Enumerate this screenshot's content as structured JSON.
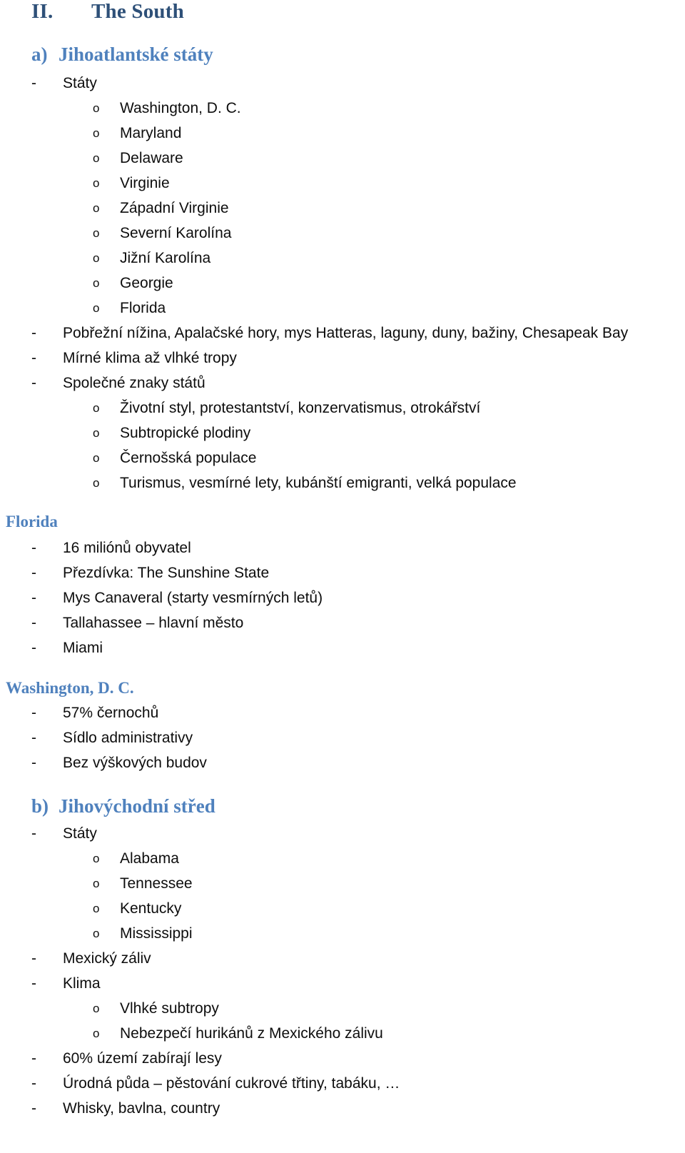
{
  "document": {
    "title": "The South",
    "language": "cs",
    "colors": {
      "heading_dark_blue": "#2E5078",
      "heading_steel_blue": "#4F81BD",
      "body_text": "#0D0D0D",
      "page_background": "#FFFFFF"
    }
  },
  "section_main": {
    "marker": "II.",
    "title": "The South"
  },
  "subsection_a": {
    "marker": "a)",
    "title": "Jihoatlantské státy",
    "items": [
      {
        "bullet": "-",
        "text": "Státy"
      },
      {
        "bullet": "o",
        "text": "Washington, D. C."
      },
      {
        "bullet": "o",
        "text": "Maryland"
      },
      {
        "bullet": "o",
        "text": "Delaware"
      },
      {
        "bullet": "o",
        "text": "Virginie"
      },
      {
        "bullet": "o",
        "text": "Západní Virginie"
      },
      {
        "bullet": "o",
        "text": "Severní Karolína"
      },
      {
        "bullet": "o",
        "text": "Jižní Karolína"
      },
      {
        "bullet": "o",
        "text": "Georgie"
      },
      {
        "bullet": "o",
        "text": "Florida"
      },
      {
        "bullet": "-",
        "text": "Pobřežní nížina, Apalačské hory, mys Hatteras, laguny, duny, bažiny, Chesapeak Bay"
      },
      {
        "bullet": "-",
        "text": "Mírné klima až vlhké tropy"
      },
      {
        "bullet": "-",
        "text": "Společné znaky států"
      },
      {
        "bullet": "o",
        "text": "Životní styl, protestantství, konzervatismus, otrokářství"
      },
      {
        "bullet": "o",
        "text": "Subtropické plodiny"
      },
      {
        "bullet": "o",
        "text": "Černošská populace"
      },
      {
        "bullet": "o",
        "text": "Turismus, vesmírné lety, kubánští emigranti, velká populace"
      }
    ]
  },
  "place_florida": {
    "title": "Florida",
    "items": [
      {
        "bullet": "-",
        "text": "16 miliónů obyvatel"
      },
      {
        "bullet": "-",
        "text": "Přezdívka: The Sunshine State"
      },
      {
        "bullet": "-",
        "text": "Mys Canaveral (starty vesmírných letů)"
      },
      {
        "bullet": "-",
        "text": "Tallahassee – hlavní město"
      },
      {
        "bullet": "-",
        "text": "Miami"
      }
    ]
  },
  "place_washington": {
    "title": "Washington, D. C.",
    "items": [
      {
        "bullet": "-",
        "text": "57% černochů"
      },
      {
        "bullet": "-",
        "text": "Sídlo administrativy"
      },
      {
        "bullet": "-",
        "text": "Bez výškových budov"
      }
    ]
  },
  "subsection_b": {
    "marker": "b)",
    "title": "Jihovýchodní střed",
    "items": [
      {
        "bullet": "-",
        "text": "Státy"
      },
      {
        "bullet": "o",
        "text": "Alabama"
      },
      {
        "bullet": "o",
        "text": "Tennessee"
      },
      {
        "bullet": "o",
        "text": "Kentucky"
      },
      {
        "bullet": "o",
        "text": "Mississippi"
      },
      {
        "bullet": "-",
        "text": "Mexický záliv"
      },
      {
        "bullet": "-",
        "text": "Klima"
      },
      {
        "bullet": "o",
        "text": "Vlhké subtropy"
      },
      {
        "bullet": "o",
        "text": "Nebezpečí hurikánů z Mexického zálivu"
      },
      {
        "bullet": "-",
        "text": "60% území zabírají lesy"
      },
      {
        "bullet": "-",
        "text": "Úrodná půda – pěstování cukrové třtiny, tabáku, …"
      },
      {
        "bullet": "-",
        "text": "Whisky, bavlna, country"
      }
    ]
  }
}
